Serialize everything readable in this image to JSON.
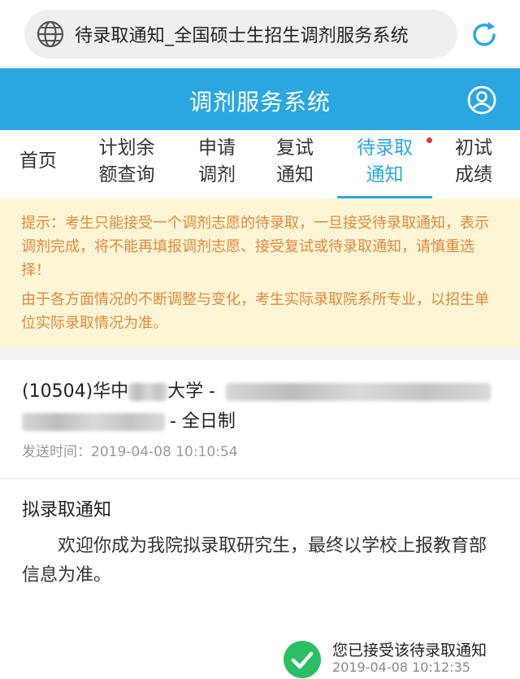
{
  "browser": {
    "url_title": "待录取通知_全国硕士生招生调剂服务系统",
    "globe_icon": "globe-icon",
    "reload_icon": "reload-icon"
  },
  "header": {
    "title": "调剂服务系统",
    "user_icon": "user-icon",
    "color": "#2aa7e0"
  },
  "tabs": [
    {
      "line1": "首页",
      "line2": ""
    },
    {
      "line1": "计划余",
      "line2": "额查询"
    },
    {
      "line1": "申请",
      "line2": "调剂"
    },
    {
      "line1": "复试",
      "line2": "通知"
    },
    {
      "line1": "待录取",
      "line2": "通知",
      "active": true,
      "has_dot": true
    },
    {
      "line1": "初试",
      "line2": "成绩"
    }
  ],
  "notice": {
    "p1": "提示：考生只能接受一个调剂志愿的待录取，一旦接受待录取通知，表示调剂完成，将不能再填报调剂志愿、接受复试或待录取通知，请慎重选择！",
    "p2": "由于各方面情况的不断调整与变化，考生实际录取院系所专业，以招生单位实际录取情况为准。"
  },
  "record": {
    "code_prefix": "(10504)华中",
    "university_suffix": "大学 -",
    "study_mode": "- 全日制",
    "sent_time": "发送时间：2019-04-08 10:10:54"
  },
  "message": {
    "title": "拟录取通知",
    "body": "欢迎你成为我院拟录取研究生，最终以学校上报教育部信息为准。"
  },
  "status": {
    "text": "您已接受该待录取通知",
    "time": "2019-04-08 10:12:35",
    "icon": "check-circle-icon",
    "color": "#2bbf63"
  }
}
